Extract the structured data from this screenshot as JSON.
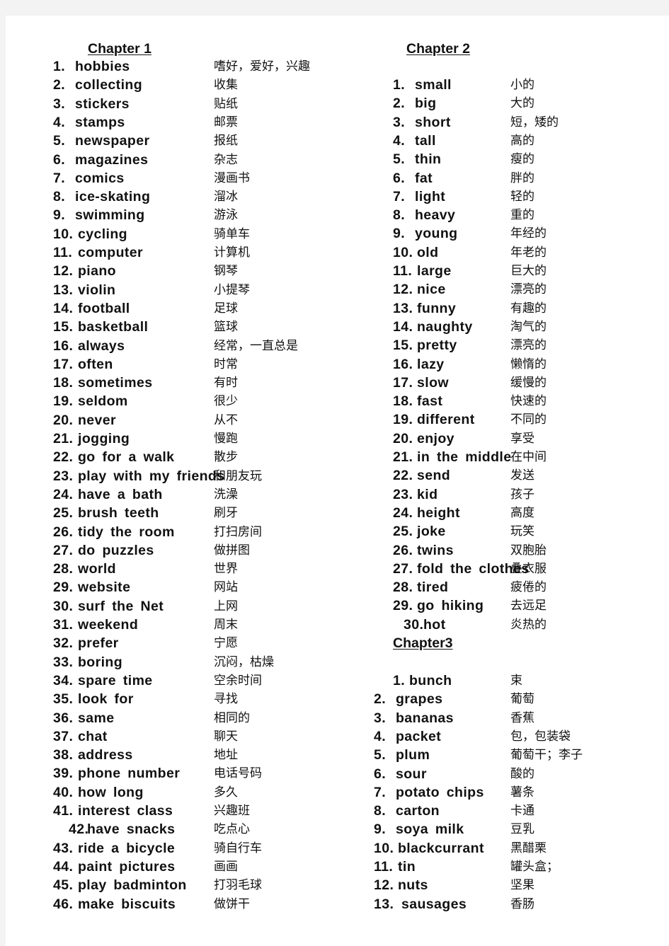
{
  "chapter1": {
    "title": "Chapter  1",
    "items": [
      {
        "num": "1.",
        "en": "hobbies",
        "zh": "嗜好，爱好，兴趣"
      },
      {
        "num": "2.",
        "en": "collecting",
        "zh": "收集"
      },
      {
        "num": "3.",
        "en": "stickers",
        "zh": "贴纸"
      },
      {
        "num": "4.",
        "en": "stamps",
        "zh": "邮票"
      },
      {
        "num": "5.",
        "en": "newspaper",
        "zh": "报纸"
      },
      {
        "num": "6.",
        "en": "magazines",
        "zh": "杂志"
      },
      {
        "num": "7.",
        "en": "comics",
        "zh": "漫画书"
      },
      {
        "num": "8.",
        "en": "ice-skating",
        "zh": "溜冰"
      },
      {
        "num": "9.",
        "en": "swimming",
        "zh": "游泳"
      },
      {
        "num": "10.",
        "en": "cycling",
        "zh": "骑单车"
      },
      {
        "num": "11.",
        "en": "computer",
        "zh": "计算机"
      },
      {
        "num": "12.",
        "en": "piano",
        "zh": "钢琴"
      },
      {
        "num": "13.",
        "en": "violin",
        "zh": "小提琴"
      },
      {
        "num": "14.",
        "en": "football",
        "zh": "足球"
      },
      {
        "num": "15.",
        "en": "basketball",
        "zh": "篮球"
      },
      {
        "num": "16.",
        "en": "always",
        "zh": "经常，一直总是"
      },
      {
        "num": "17.",
        "en": "often",
        "zh": "时常"
      },
      {
        "num": "18.",
        "en": "sometimes",
        "zh": "有时"
      },
      {
        "num": "19.",
        "en": "seldom",
        "zh": "很少"
      },
      {
        "num": "20.",
        "en": "never",
        "zh": "从不"
      },
      {
        "num": "21.",
        "en": "jogging",
        "zh": "慢跑"
      },
      {
        "num": "22.",
        "en": "go for a walk",
        "zh": "散步"
      },
      {
        "num": "23.",
        "en": "play with my friends",
        "zh": "和朋友玩"
      },
      {
        "num": "24.",
        "en": "have a bath",
        "zh": "洗澡"
      },
      {
        "num": "25.",
        "en": "brush teeth",
        "zh": "刷牙"
      },
      {
        "num": "26.",
        "en": "tidy the room",
        "zh": "打扫房间"
      },
      {
        "num": "27.",
        "en": "do puzzles",
        "zh": "做拼图"
      },
      {
        "num": "28.",
        "en": "world",
        "zh": "世界"
      },
      {
        "num": "29.",
        "en": "website",
        "zh": "网站"
      },
      {
        "num": "30.",
        "en": "surf the Net",
        "zh": "上网"
      },
      {
        "num": "31.",
        "en": "weekend",
        "zh": "周末"
      },
      {
        "num": "32.",
        "en": "prefer",
        "zh": "宁愿"
      },
      {
        "num": "33.",
        "en": "boring",
        "zh": "沉闷，枯燥"
      },
      {
        "num": "34.",
        "en": "spare time",
        "zh": "空余时间"
      },
      {
        "num": "35.",
        "en": "look for",
        "zh": "寻找"
      },
      {
        "num": "36.",
        "en": "same",
        "zh": "相同的"
      },
      {
        "num": "37.",
        "en": "chat",
        "zh": "聊天"
      },
      {
        "num": "38.",
        "en": "address",
        "zh": "地址"
      },
      {
        "num": "39.",
        "en": "phone number",
        "zh": "电话号码"
      },
      {
        "num": "40.",
        "en": "how long",
        "zh": "多久"
      },
      {
        "num": "41.",
        "en": "interest class",
        "zh": "兴趣班"
      },
      {
        "num": "42.",
        "en": "have snacks",
        "zh": "吃点心"
      },
      {
        "num": "43.",
        "en": "ride a bicycle",
        "zh": "骑自行车"
      },
      {
        "num": "44.",
        "en": "paint pictures",
        "zh": "画画"
      },
      {
        "num": "45.",
        "en": "play badminton",
        "zh": "打羽毛球"
      },
      {
        "num": "46.",
        "en": "make biscuits",
        "zh": "做饼干"
      }
    ]
  },
  "chapter2": {
    "title": "Chapter  2",
    "items": [
      {
        "num": "1.",
        "en": "small",
        "zh": "小的"
      },
      {
        "num": "2.",
        "en": "big",
        "zh": "大的"
      },
      {
        "num": "3.",
        "en": "short",
        "zh": "短，矮的"
      },
      {
        "num": "4.",
        "en": "tall",
        "zh": "高的"
      },
      {
        "num": "5.",
        "en": "thin",
        "zh": "瘦的"
      },
      {
        "num": "6.",
        "en": "fat",
        "zh": "胖的"
      },
      {
        "num": "7.",
        "en": "light",
        "zh": "轻的"
      },
      {
        "num": "8.",
        "en": "heavy",
        "zh": "重的"
      },
      {
        "num": "9.",
        "en": "young",
        "zh": "年经的"
      },
      {
        "num": "10.",
        "en": "old",
        "zh": "年老的"
      },
      {
        "num": "11.",
        "en": "large",
        "zh": "巨大的"
      },
      {
        "num": "12.",
        "en": "nice",
        "zh": "漂亮的"
      },
      {
        "num": "13.",
        "en": "funny",
        "zh": "有趣的"
      },
      {
        "num": "14.",
        "en": "naughty",
        "zh": "淘气的"
      },
      {
        "num": "15.",
        "en": "pretty",
        "zh": "漂亮的"
      },
      {
        "num": "16.",
        "en": "lazy",
        "zh": "懒惰的"
      },
      {
        "num": "17.",
        "en": "slow",
        "zh": "缓慢的"
      },
      {
        "num": "18.",
        "en": "fast",
        "zh": "快速的"
      },
      {
        "num": "19.",
        "en": "different",
        "zh": "不同的"
      },
      {
        "num": "20.",
        "en": "enjoy",
        "zh": "享受"
      },
      {
        "num": "21.",
        "en": "in the middle",
        "zh": "在中间"
      },
      {
        "num": "22.",
        "en": "send",
        "zh": "发送"
      },
      {
        "num": "23.",
        "en": "kid",
        "zh": "孩子"
      },
      {
        "num": "24.",
        "en": "height",
        "zh": "高度"
      },
      {
        "num": "25.",
        "en": "joke",
        "zh": "玩笑"
      },
      {
        "num": "26.",
        "en": "twins",
        "zh": "双胞胎"
      },
      {
        "num": "27.",
        "en": "fold the clothes",
        "zh": "叠衣服"
      },
      {
        "num": "28.",
        "en": "tired",
        "zh": "疲倦的"
      },
      {
        "num": "29.",
        "en": "go hiking",
        "zh": "去远足"
      },
      {
        "num": "30.",
        "en": "hot",
        "zh": "炎热的"
      }
    ]
  },
  "chapter3": {
    "title": "Chapter3",
    "items": [
      {
        "num": "1.",
        "en": "bunch",
        "zh": "束"
      },
      {
        "num": "2.",
        "en": "grapes",
        "zh": "葡萄"
      },
      {
        "num": "3.",
        "en": "bananas",
        "zh": "香蕉"
      },
      {
        "num": "4.",
        "en": "packet",
        "zh": "包，包装袋"
      },
      {
        "num": "5.",
        "en": "plum",
        "zh": "葡萄干；李子"
      },
      {
        "num": "6.",
        "en": "sour",
        "zh": "酸的"
      },
      {
        "num": "7.",
        "en": "potato chips",
        "zh": "薯条"
      },
      {
        "num": "8.",
        "en": "carton",
        "zh": "卡通"
      },
      {
        "num": "9.",
        "en": "soya milk",
        "zh": "豆乳"
      },
      {
        "num": "10.",
        "en": "blackcurrant",
        "zh": "黑醋栗"
      },
      {
        "num": "11.",
        "en": "tin",
        "zh": "罐头盒；"
      },
      {
        "num": "12.",
        "en": "nuts",
        "zh": "坚果"
      },
      {
        "num": "13.",
        "en": "sausages",
        "zh": "香肠"
      }
    ]
  }
}
